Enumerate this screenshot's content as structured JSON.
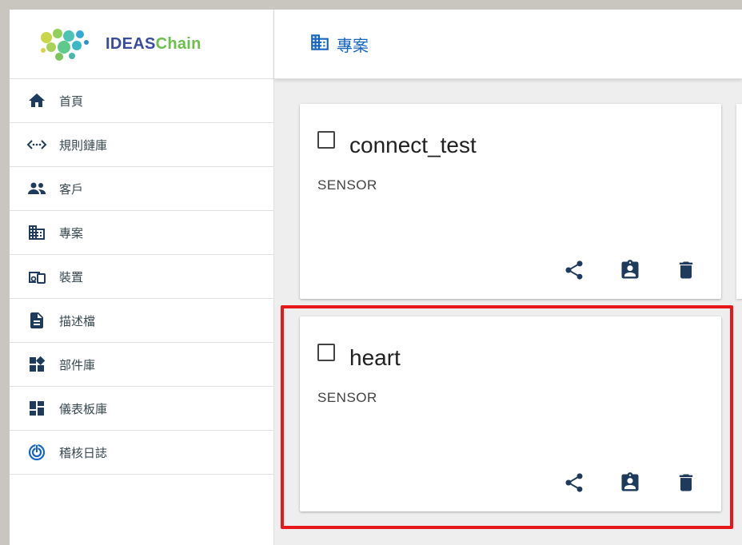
{
  "app": {
    "logo_ideas": "IDEAS",
    "logo_chain": "Chain"
  },
  "sidebar": {
    "items": [
      {
        "label": "首頁",
        "icon": "home-icon"
      },
      {
        "label": "規則鏈庫",
        "icon": "code-icon"
      },
      {
        "label": "客戶",
        "icon": "people-icon"
      },
      {
        "label": "專案",
        "icon": "domain-icon"
      },
      {
        "label": "裝置",
        "icon": "devices-icon"
      },
      {
        "label": "描述檔",
        "icon": "description-icon"
      },
      {
        "label": "部件庫",
        "icon": "widgets-icon"
      },
      {
        "label": "儀表板庫",
        "icon": "dashboard-icon"
      },
      {
        "label": "稽核日誌",
        "icon": "track-changes-icon"
      }
    ]
  },
  "header": {
    "title": "專案",
    "icon": "domain-icon"
  },
  "cards": [
    {
      "title": "connect_test",
      "type": "SENSOR"
    },
    {
      "title": "heart",
      "type": "SENSOR"
    }
  ],
  "colors": {
    "accent": "#1565c0",
    "icon": "#1e3a5c",
    "highlight": "#e8181a",
    "logo_blue": "#3a4a9c",
    "logo_green": "#6bbf4a"
  }
}
